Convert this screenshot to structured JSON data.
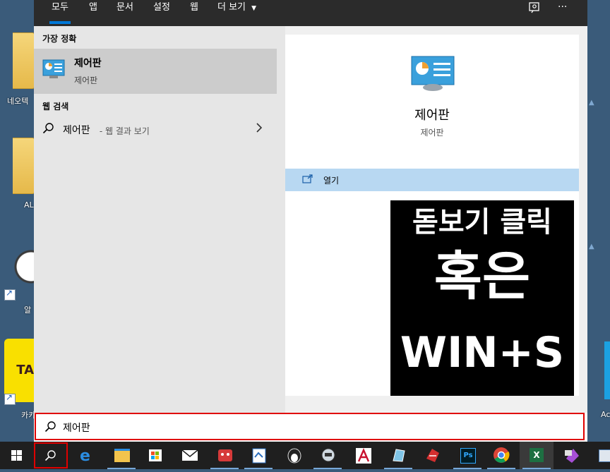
{
  "tabs": [
    {
      "label": "모두",
      "active": true
    },
    {
      "label": "앱"
    },
    {
      "label": "문서"
    },
    {
      "label": "설정"
    },
    {
      "label": "웹"
    },
    {
      "label": "더 보기"
    }
  ],
  "more_button": "···",
  "left_panel": {
    "best_match_heading": "가장 정확",
    "best_match": {
      "title": "제어판",
      "subtitle": "제어판",
      "icon": "control-panel-icon"
    },
    "web_heading": "웹 검색",
    "web_item": {
      "text": "제어판",
      "suffix": " - 웹 결과 보기"
    }
  },
  "right_panel": {
    "title": "제어판",
    "subtitle": "제어판",
    "open_label": "열기"
  },
  "overlay": {
    "line1": "돋보기 클릭",
    "line2": "혹은",
    "line3": "WIN+S"
  },
  "search": {
    "value": "제어판"
  },
  "desktop_labels": [
    "네오텍",
    "AL",
    "알",
    "카카",
    "Ac"
  ],
  "taskbar_items": [
    "start",
    "search",
    "edge",
    "file-explorer",
    "store",
    "mail",
    "app-red",
    "app-blue",
    "penguin",
    "app-bot",
    "acrobat",
    "app-glass",
    "app-red2",
    "photoshop",
    "chrome",
    "excel",
    "app-purple",
    "app-last"
  ],
  "colors": {
    "accent": "#0078d7",
    "highlight_border": "#e00000",
    "selected_row": "#b8d8f2"
  }
}
